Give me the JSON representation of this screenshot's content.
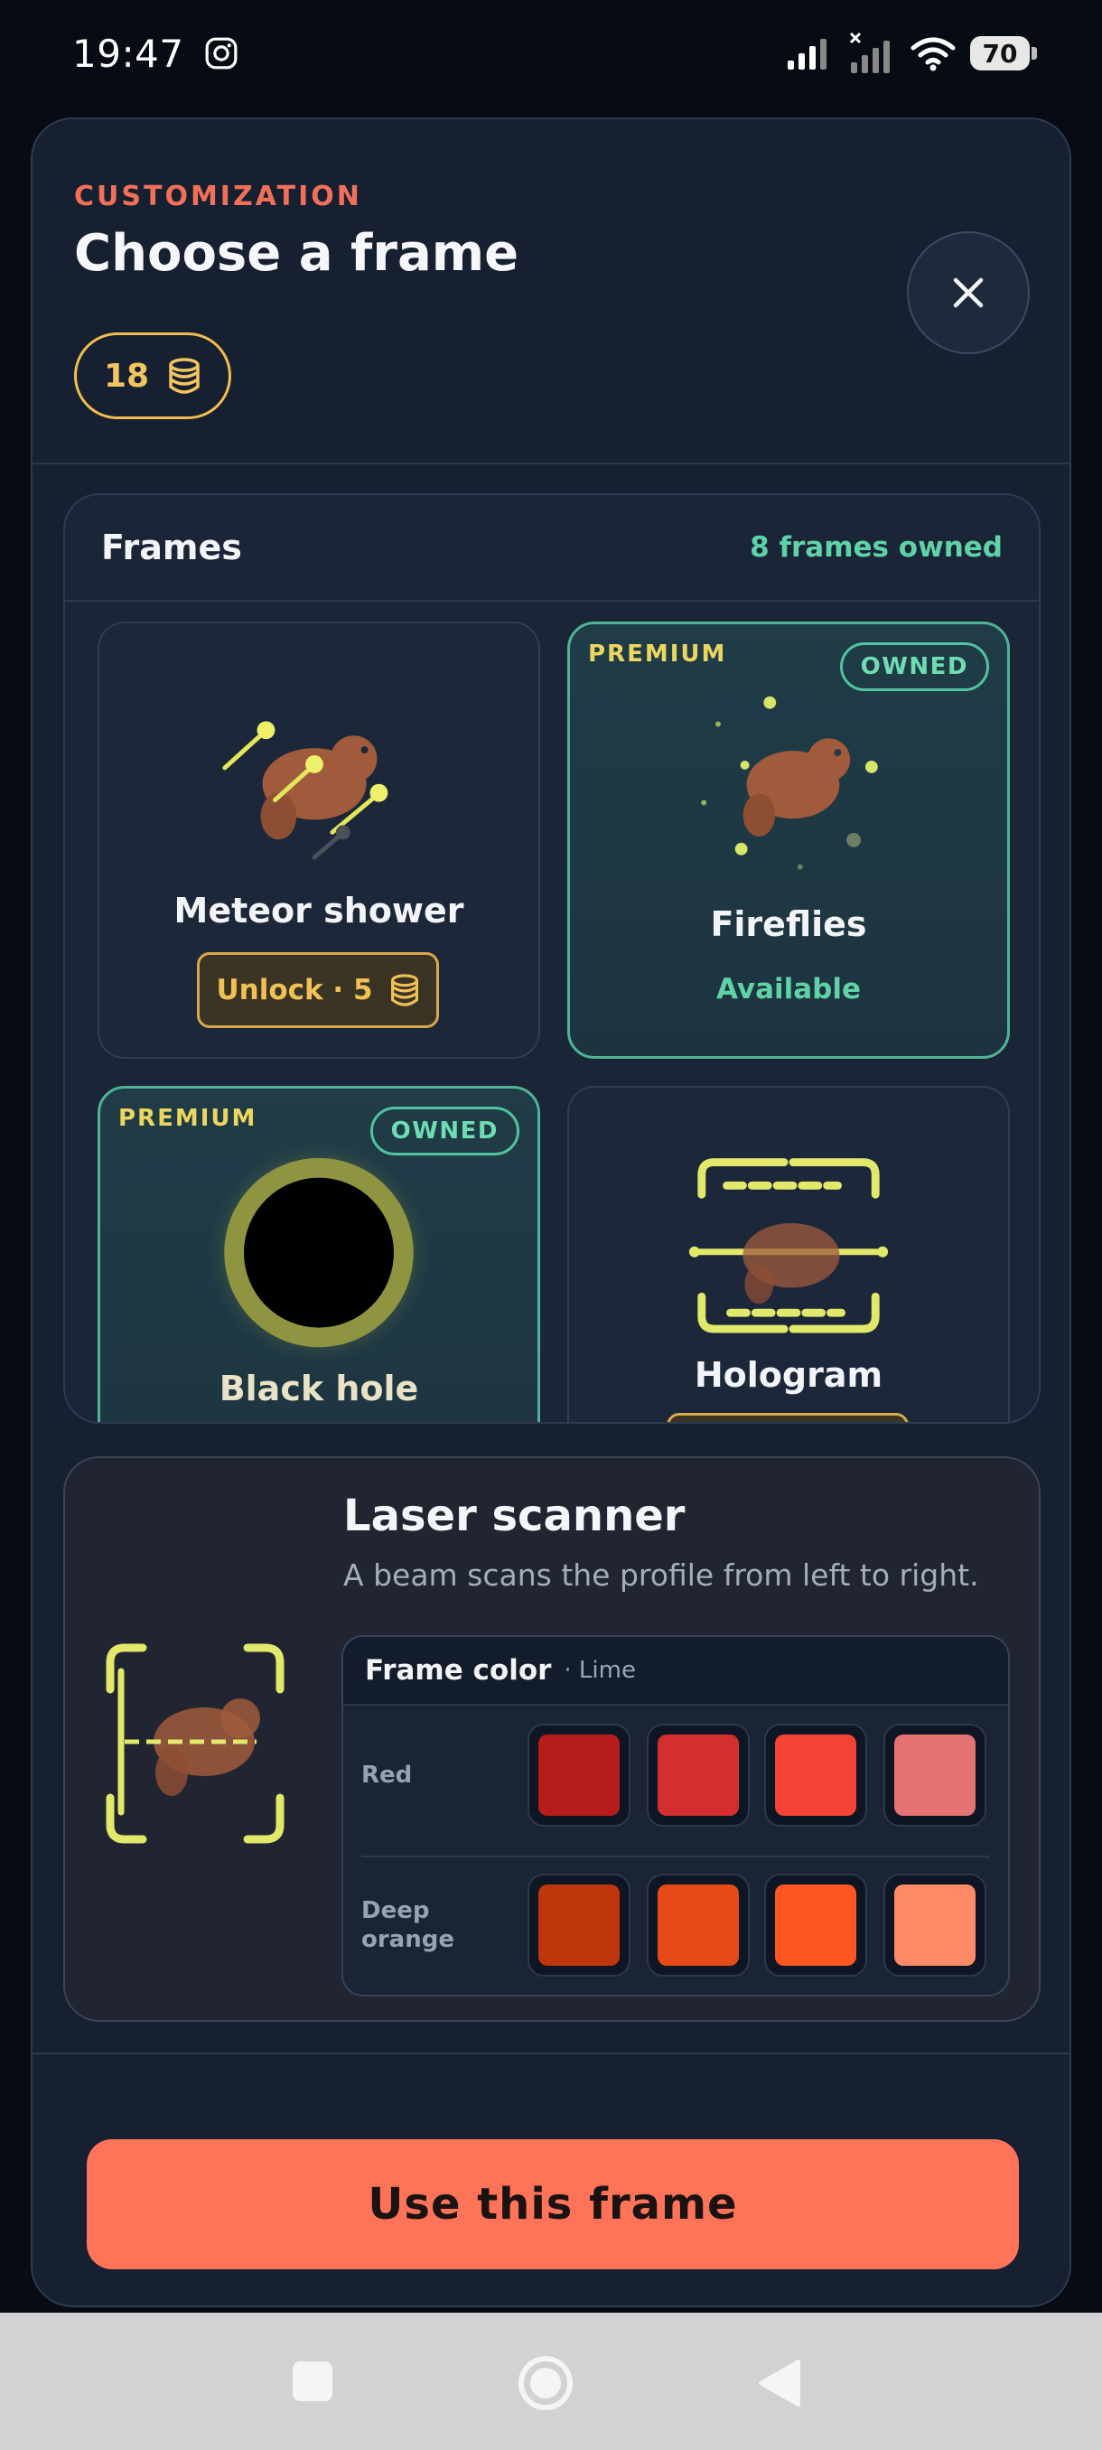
{
  "status_bar": {
    "time": "19:47",
    "battery": "70"
  },
  "header": {
    "eyebrow": "CUSTOMIZATION",
    "title": "Choose a frame",
    "coin_balance": "18",
    "close_icon": "close-icon"
  },
  "frames": {
    "title": "Frames",
    "owned_count_text": "8 frames owned",
    "items": [
      {
        "name": "Meteor shower",
        "unlock_label": "Unlock · 5",
        "premium": false,
        "owned": false
      },
      {
        "name": "Fireflies",
        "status": "Available",
        "premium_label": "PREMIUM",
        "owned_label": "OWNED",
        "premium": true,
        "owned": true
      },
      {
        "name": "Black hole",
        "premium_label": "PREMIUM",
        "owned_label": "OWNED",
        "premium": true,
        "owned": true
      },
      {
        "name": "Hologram",
        "premium": false,
        "owned": false
      }
    ]
  },
  "detail": {
    "title": "Laser scanner",
    "description": "A beam scans the profile from left to right.",
    "color_section": {
      "title": "Frame color",
      "selected": "· Lime",
      "rows": [
        {
          "label": "Red",
          "swatches": [
            "#b71c1c",
            "#d32f2f",
            "#f44336",
            "#e57373"
          ]
        },
        {
          "label": "Deep orange",
          "swatches": [
            "#bf360c",
            "#e64a19",
            "#ff5722",
            "#ff8a65"
          ]
        }
      ]
    }
  },
  "cta": {
    "label": "Use this frame"
  },
  "colors": {
    "accent": "#ff7459",
    "owned_green": "#5fd3a6",
    "coin_gold": "#f3c560",
    "lime": "#d4e157"
  }
}
